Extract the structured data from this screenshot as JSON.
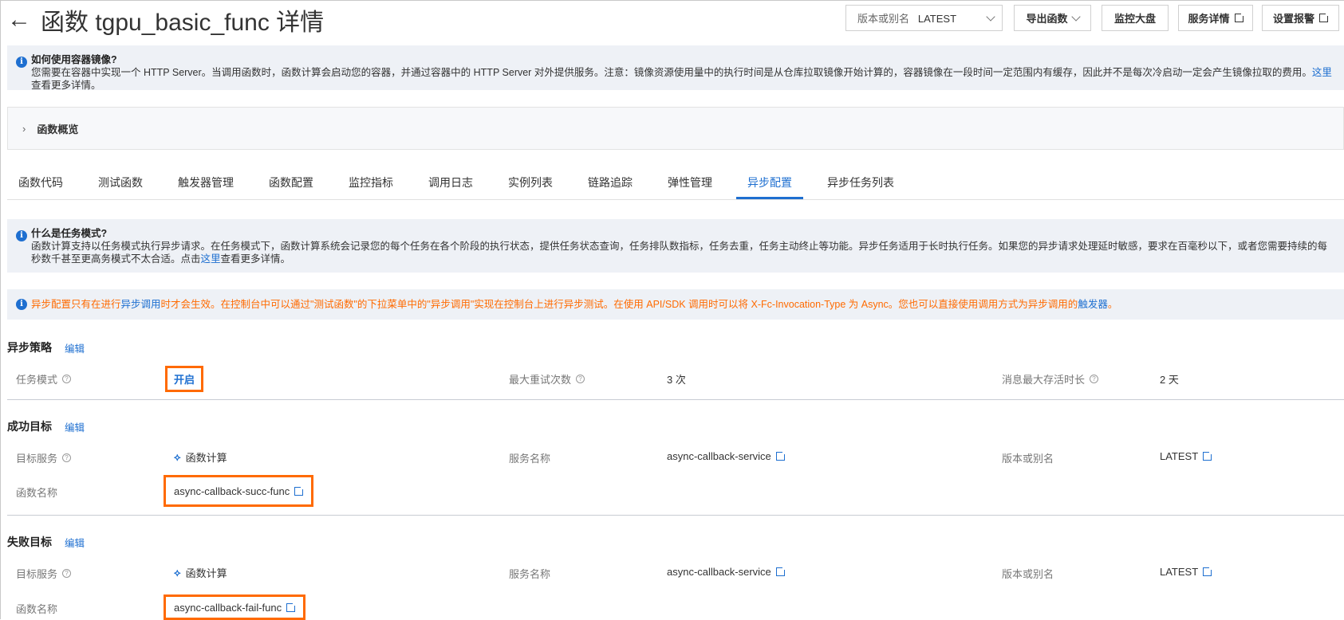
{
  "header": {
    "title": "函数 tgpu_basic_func 详情",
    "version_label": "版本或别名",
    "version_value": "LATEST",
    "export": "导出函数",
    "monitor": "监控大盘",
    "service_detail": "服务详情",
    "alarm": "设置报警"
  },
  "info_container": {
    "title": "如何使用容器镜像?",
    "text": "您需要在容器中实现一个 HTTP Server。当调用函数时，函数计算会启动您的容器，并通过容器中的 HTTP Server 对外提供服务。注意：镜像资源使用量中的执行时间是从仓库拉取镜像开始计算的，容器镜像在一段时间一定范围内有缓存，因此并不是每次冷启动一定会产生镜像拉取的费用。",
    "link": "这里",
    "suffix": "查看更多详情。"
  },
  "overview": {
    "label": "函数概览"
  },
  "tabs": [
    "函数代码",
    "测试函数",
    "触发器管理",
    "函数配置",
    "监控指标",
    "调用日志",
    "实例列表",
    "链路追踪",
    "弹性管理",
    "异步配置",
    "异步任务列表"
  ],
  "active_tab": 9,
  "info_task": {
    "title": "什么是任务模式?",
    "text": "函数计算支持以任务模式执行异步请求。在任务模式下，函数计算系统会记录您的每个任务在各个阶段的执行状态，提供任务状态查询，任务排队数指标，任务去重，任务主动终止等功能。异步任务适用于长时执行任务。如果您的异步请求处理延时敏感，要求在百毫秒以下，或者您需要持续的每秒数千甚至更高务模式不太合适。点击",
    "link": "这里",
    "suffix": "查看更多详情。"
  },
  "info_async": {
    "p1": "异步配置只有在进行",
    "link1": "异步调用",
    "p2": "时才会生效。在控制台中可以通过\"测试函数\"的下拉菜单中的\"异步调用\"实现在控制台上进行异步测试。在使用 API/SDK 调用时可以将 X-Fc-Invocation-Type 为 Async。您也可以直接使用调用方式为异步调用的",
    "link2": "触发器",
    "p3": "。"
  },
  "policy": {
    "title": "异步策略",
    "edit": "编辑",
    "task_mode_label": "任务模式",
    "task_mode_value": "开启",
    "retry_label": "最大重试次数",
    "retry_value": "3 次",
    "ttl_label": "消息最大存活时长",
    "ttl_value": "2 天"
  },
  "success": {
    "title": "成功目标",
    "edit": "编辑",
    "target_label": "目标服务",
    "target_value": "函数计算",
    "service_label": "服务名称",
    "service_value": "async-callback-service",
    "version_label": "版本或别名",
    "version_value": "LATEST",
    "func_label": "函数名称",
    "func_value": "async-callback-succ-func"
  },
  "fail": {
    "title": "失败目标",
    "edit": "编辑",
    "target_label": "目标服务",
    "target_value": "函数计算",
    "service_label": "服务名称",
    "service_value": "async-callback-service",
    "version_label": "版本或别名",
    "version_value": "LATEST",
    "func_label": "函数名称",
    "func_value": "async-callback-fail-func"
  }
}
